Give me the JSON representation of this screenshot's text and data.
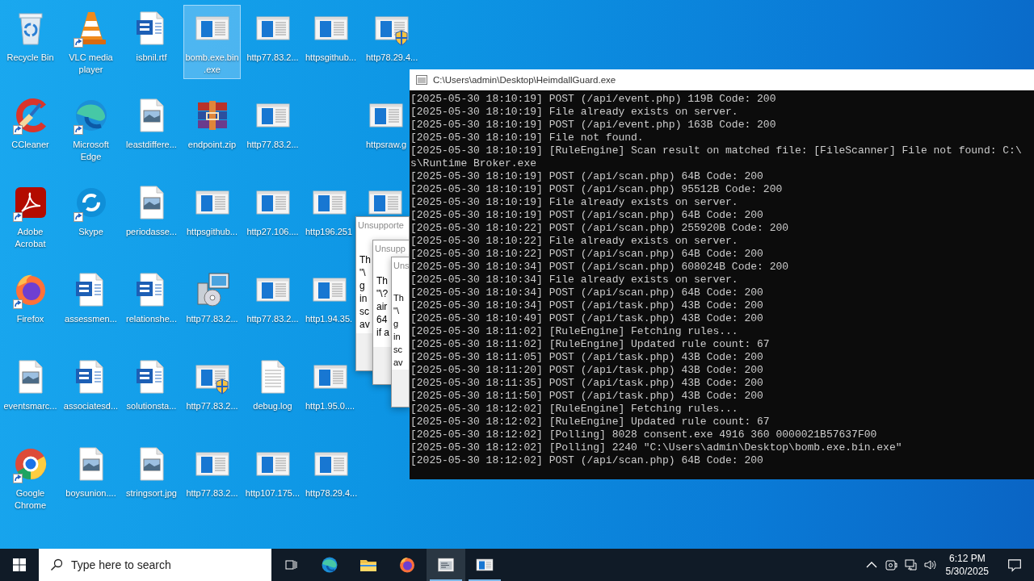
{
  "desktop": {
    "columns": [
      {
        "icons": [
          {
            "kind": "recycle-bin",
            "label": "Recycle Bin",
            "shortcut": false,
            "selected": false
          },
          {
            "kind": "ccleaner",
            "label": "CCleaner",
            "shortcut": true,
            "selected": false
          },
          {
            "kind": "acrobat",
            "label": "Adobe Acrobat",
            "shortcut": true,
            "selected": false
          },
          {
            "kind": "firefox",
            "label": "Firefox",
            "shortcut": true,
            "selected": false
          },
          {
            "kind": "image",
            "label": "eventsmarc...",
            "shortcut": false,
            "selected": false
          },
          {
            "kind": "chrome",
            "label": "Google Chrome",
            "shortcut": true,
            "selected": false
          }
        ]
      },
      {
        "icons": [
          {
            "kind": "cone",
            "label": "VLC media player",
            "shortcut": true,
            "selected": false
          },
          {
            "kind": "edge",
            "label": "Microsoft Edge",
            "shortcut": true,
            "selected": false
          },
          {
            "kind": "skype",
            "label": "Skype",
            "shortcut": true,
            "selected": false
          },
          {
            "kind": "word",
            "label": "assessmen...",
            "shortcut": false,
            "selected": false
          },
          {
            "kind": "word",
            "label": "associatesd...",
            "shortcut": false,
            "selected": false
          },
          {
            "kind": "image",
            "label": "boysunion....",
            "shortcut": false,
            "selected": false
          }
        ]
      },
      {
        "icons": [
          {
            "kind": "word",
            "label": "isbnil.rtf",
            "shortcut": false,
            "selected": false
          },
          {
            "kind": "image",
            "label": "leastdiffere...",
            "shortcut": false,
            "selected": false
          },
          {
            "kind": "image",
            "label": "periodasse...",
            "shortcut": false,
            "selected": false
          },
          {
            "kind": "word",
            "label": "relationshe...",
            "shortcut": false,
            "selected": false
          },
          {
            "kind": "word",
            "label": "solutionsta...",
            "shortcut": false,
            "selected": false
          },
          {
            "kind": "image",
            "label": "stringsort.jpg",
            "shortcut": false,
            "selected": false
          }
        ]
      },
      {
        "icons": [
          {
            "kind": "app",
            "label": "bomb.exe.bin.exe",
            "shortcut": false,
            "selected": true
          },
          {
            "kind": "archive",
            "label": "endpoint.zip",
            "shortcut": false,
            "selected": false
          },
          {
            "kind": "app",
            "label": "httpsgithub...",
            "shortcut": false,
            "selected": false
          },
          {
            "kind": "installer",
            "label": "http77.83.2...",
            "shortcut": false,
            "selected": false
          },
          {
            "kind": "shield",
            "label": "http77.83.2...",
            "shortcut": false,
            "selected": false
          },
          {
            "kind": "app",
            "label": "http77.83.2...",
            "shortcut": false,
            "selected": false
          }
        ]
      },
      {
        "icons": [
          {
            "kind": "app",
            "label": "http77.83.2...",
            "shortcut": false,
            "selected": false
          },
          {
            "kind": "app",
            "label": "http77.83.2...",
            "shortcut": false,
            "selected": false
          },
          {
            "kind": "app",
            "label": "http27.106....",
            "shortcut": false,
            "selected": false
          },
          {
            "kind": "app",
            "label": "http77.83.2...",
            "shortcut": false,
            "selected": false
          },
          {
            "kind": "text",
            "label": "debug.log",
            "shortcut": false,
            "selected": false
          },
          {
            "kind": "app",
            "label": "http107.175...",
            "shortcut": false,
            "selected": false
          }
        ]
      },
      {
        "icons": [
          {
            "kind": "app",
            "label": "httpsgithub...",
            "shortcut": false,
            "selected": false
          },
          {
            "kind": "blank"
          },
          {
            "kind": "app",
            "label": "http196.251",
            "shortcut": false,
            "selected": false
          },
          {
            "kind": "app",
            "label": "http1.94.35.",
            "shortcut": false,
            "selected": false
          },
          {
            "kind": "app",
            "label": "http1.95.0....",
            "shortcut": false,
            "selected": false
          },
          {
            "kind": "app",
            "label": "http78.29.4...",
            "shortcut": false,
            "selected": false
          }
        ]
      },
      {
        "icons": [
          {
            "kind": "shield",
            "label": "http78.29.4...",
            "shortcut": false,
            "selected": false
          },
          {
            "kind": "app",
            "label": "httpsraw.g",
            "shortcut": false,
            "selected": false
          },
          {
            "kind": "app",
            "shortcut": false,
            "selected": false
          }
        ]
      }
    ]
  },
  "dialogs": [
    {
      "title": "Unsupporte",
      "lines": [
        "Th",
        "\"\\",
        "g",
        "in",
        "sc",
        "av"
      ]
    },
    {
      "title": "Unsupp",
      "lines": [
        "Th",
        "\"\\?",
        "air",
        "64",
        "if a"
      ]
    },
    {
      "title": "Uns",
      "lines": [
        "Th",
        "\"\\",
        "g",
        "in",
        "sc",
        "av"
      ]
    }
  ],
  "console": {
    "title": "C:\\Users\\admin\\Desktop\\HeimdallGuard.exe",
    "lines": [
      "[2025-05-30 18:10:19] POST (/api/event.php) 119B Code: 200",
      "[2025-05-30 18:10:19] File already exists on server.",
      "[2025-05-30 18:10:19] POST (/api/event.php) 163B Code: 200",
      "[2025-05-30 18:10:19] File not found.",
      "[2025-05-30 18:10:19] [RuleEngine] Scan result on matched file: [FileScanner] File not found: C:\\",
      "s\\Runtime Broker.exe",
      "[2025-05-30 18:10:19] POST (/api/scan.php) 64B Code: 200",
      "[2025-05-30 18:10:19] POST (/api/scan.php) 95512B Code: 200",
      "[2025-05-30 18:10:19] File already exists on server.",
      "[2025-05-30 18:10:19] POST (/api/scan.php) 64B Code: 200",
      "[2025-05-30 18:10:22] POST (/api/scan.php) 255920B Code: 200",
      "[2025-05-30 18:10:22] File already exists on server.",
      "[2025-05-30 18:10:22] POST (/api/scan.php) 64B Code: 200",
      "[2025-05-30 18:10:34] POST (/api/scan.php) 608024B Code: 200",
      "[2025-05-30 18:10:34] File already exists on server.",
      "[2025-05-30 18:10:34] POST (/api/scan.php) 64B Code: 200",
      "[2025-05-30 18:10:34] POST (/api/task.php) 43B Code: 200",
      "[2025-05-30 18:10:49] POST (/api/task.php) 43B Code: 200",
      "[2025-05-30 18:11:02] [RuleEngine] Fetching rules...",
      "[2025-05-30 18:11:02] [RuleEngine] Updated rule count: 67",
      "[2025-05-30 18:11:05] POST (/api/task.php) 43B Code: 200",
      "[2025-05-30 18:11:20] POST (/api/task.php) 43B Code: 200",
      "[2025-05-30 18:11:35] POST (/api/task.php) 43B Code: 200",
      "[2025-05-30 18:11:50] POST (/api/task.php) 43B Code: 200",
      "[2025-05-30 18:12:02] [RuleEngine] Fetching rules...",
      "[2025-05-30 18:12:02] [RuleEngine] Updated rule count: 67",
      "[2025-05-30 18:12:02] [Polling] 8028 consent.exe 4916 360 0000021B57637F00",
      "[2025-05-30 18:12:02] [Polling] 2240 \"C:\\Users\\admin\\Desktop\\bomb.exe.bin.exe\"",
      "[2025-05-30 18:12:02] POST (/api/scan.php) 64B Code: 200"
    ]
  },
  "taskbar": {
    "search": {
      "placeholder": "Type here to search"
    },
    "apps": [
      {
        "kind": "edge",
        "running": false,
        "selected": false
      },
      {
        "kind": "folder",
        "running": false,
        "selected": false
      },
      {
        "kind": "firefox",
        "running": false,
        "selected": false
      },
      {
        "kind": "console",
        "running": true,
        "selected": true
      },
      {
        "kind": "app",
        "running": true,
        "selected": false
      }
    ],
    "clock": {
      "time": "6:12 PM",
      "date": "5/30/2025"
    }
  }
}
